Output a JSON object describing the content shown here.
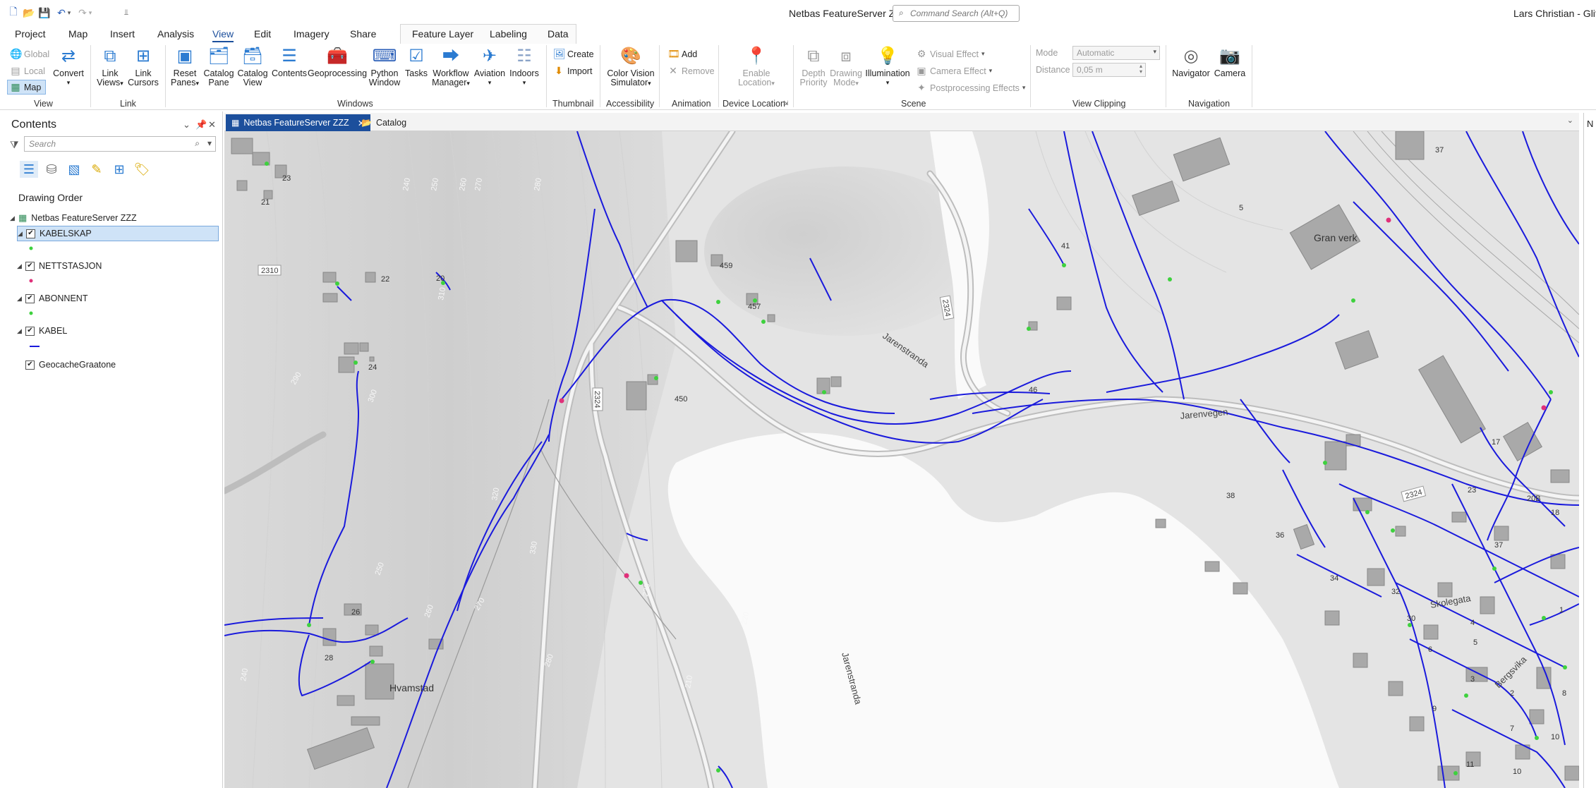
{
  "window": {
    "title": "Netbas FeatureServer ZZZ",
    "command_search_placeholder": "Command Search (Alt+Q)",
    "user": "Lars Christian - Glitre E"
  },
  "quick_access": {
    "icons": [
      "new-project-icon",
      "open-project-icon",
      "save-project-icon",
      "undo-icon",
      "undo-dropdown-icon",
      "redo-icon",
      "redo-dropdown-icon",
      "customize-qat-icon"
    ]
  },
  "ribbon_tabs": [
    "Project",
    "Map",
    "Insert",
    "Analysis",
    "View",
    "Edit",
    "Imagery",
    "Share",
    "Feature Layer",
    "Labeling",
    "Data"
  ],
  "active_tab": "View",
  "ribbon": {
    "view_group": {
      "global": "Global",
      "local": "Local",
      "map": "Map",
      "convert": "Convert",
      "label": "View"
    },
    "link_group": {
      "link_views_1": "Link",
      "link_views_2": "Views",
      "link_cursors_1": "Link",
      "link_cursors_2": "Cursors",
      "label": "Link"
    },
    "windows_group": {
      "reset_panes_1": "Reset",
      "reset_panes_2": "Panes",
      "catalog_pane_1": "Catalog",
      "catalog_pane_2": "Pane",
      "catalog_view_1": "Catalog",
      "catalog_view_2": "View",
      "contents": "Contents",
      "geoprocessing": "Geoprocessing",
      "python_window_1": "Python",
      "python_window_2": "Window",
      "tasks": "Tasks",
      "workflow_manager_1": "Workflow",
      "workflow_manager_2": "Manager",
      "aviation": "Aviation",
      "indoors": "Indoors",
      "label": "Windows"
    },
    "thumbnail_group": {
      "create": "Create",
      "import": "Import",
      "label": "Thumbnail"
    },
    "accessibility_group": {
      "color_vision_1": "Color Vision",
      "color_vision_2": "Simulator",
      "label": "Accessibility"
    },
    "animation_group": {
      "add": "Add",
      "remove": "Remove",
      "label": "Animation"
    },
    "device_location_group": {
      "enable_1": "Enable",
      "enable_2": "Location",
      "label": "Device Location"
    },
    "scene_group": {
      "depth_priority_1": "Depth",
      "depth_priority_2": "Priority",
      "drawing_mode_1": "Drawing",
      "drawing_mode_2": "Mode",
      "illumination": "Illumination",
      "visual_effect": "Visual Effect",
      "camera_effect": "Camera Effect",
      "postprocessing": "Postprocessing Effects",
      "label": "Scene"
    },
    "view_clipping_group": {
      "mode_label": "Mode",
      "mode_value": "Automatic",
      "distance_label": "Distance",
      "distance_value": "0,05  m",
      "label": "View Clipping"
    },
    "navigation_group": {
      "navigator": "Navigator",
      "camera": "Camera",
      "label": "Navigation"
    }
  },
  "contents_pane": {
    "title": "Contents",
    "search_placeholder": "Search",
    "heading": "Drawing Order",
    "map_name": "Netbas FeatureServer ZZZ",
    "layers": [
      {
        "name": "KABELSKAP",
        "symbol_color": "#3ed13e",
        "symbol": "point",
        "selected": true
      },
      {
        "name": "NETTSTASJON",
        "symbol_color": "#e0307a",
        "symbol": "point",
        "selected": false
      },
      {
        "name": "ABONNENT",
        "symbol_color": "#3ed13e",
        "symbol": "point",
        "selected": false
      },
      {
        "name": "KABEL",
        "symbol_color": "#1a1adc",
        "symbol": "line",
        "selected": false
      },
      {
        "name": "GeocacheGraatone",
        "symbol_color": "",
        "symbol": "none",
        "selected": false
      }
    ]
  },
  "map_tabs": [
    {
      "label": "Netbas FeatureServer ZZZ",
      "active": true
    },
    {
      "label": "Catalog",
      "active": false
    }
  ],
  "right_pane_letter": "N",
  "map": {
    "cable_color": "#1a1adc",
    "place_labels": [
      "Gran verk",
      "Hvamstad"
    ],
    "road_labels": [
      "Jarenstranda",
      "Jarenvegen",
      "Jarenstranda",
      "Bergsvika",
      "Skolegata"
    ],
    "road_numbers": [
      "2310",
      "2324",
      "2324",
      "2324",
      "2324"
    ],
    "house_numbers": [
      "23",
      "21",
      "22",
      "20",
      "24",
      "26",
      "28",
      "459",
      "457",
      "450",
      "41",
      "46",
      "5",
      "37",
      "17",
      "38",
      "36",
      "34",
      "32",
      "30",
      "4",
      "5",
      "6",
      "3",
      "1",
      "2",
      "9",
      "7",
      "8",
      "10",
      "11",
      "10",
      "18",
      "20B",
      "23",
      "37"
    ],
    "contour_values": [
      "240",
      "250",
      "260",
      "270",
      "280",
      "290",
      "300",
      "310",
      "320",
      "330",
      "280",
      "270",
      "260",
      "250",
      "240",
      "230",
      "220",
      "210"
    ]
  }
}
